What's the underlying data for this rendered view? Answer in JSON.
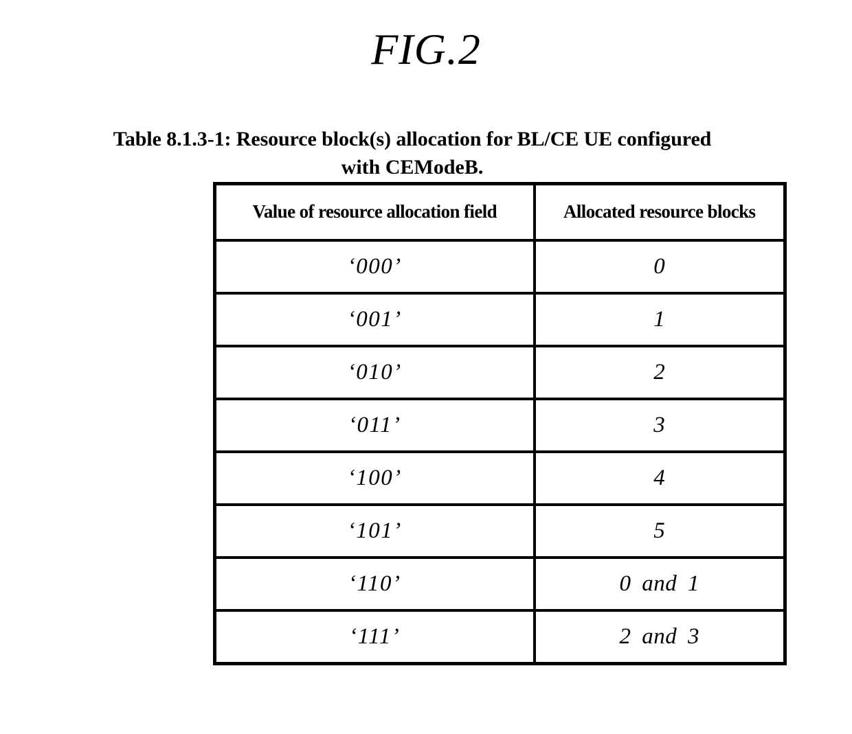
{
  "figure": {
    "title": "FIG.2"
  },
  "caption": {
    "line1": "Table 8.1.3-1: Resource block(s) allocation for BL/CE UE configured",
    "line2": "with CEModeB."
  },
  "table": {
    "headers": {
      "col1": "Value of resource allocation field",
      "col2": "Allocated resource blocks"
    },
    "rows": [
      {
        "value": "‘000’",
        "blocks": "0"
      },
      {
        "value": "‘001’",
        "blocks": "1"
      },
      {
        "value": "‘010’",
        "blocks": "2"
      },
      {
        "value": "‘011’",
        "blocks": "3"
      },
      {
        "value": "‘100’",
        "blocks": "4"
      },
      {
        "value": "‘101’",
        "blocks": "5"
      },
      {
        "value": "‘110’",
        "blocks": "0 and 1"
      },
      {
        "value": "‘111’",
        "blocks": "2 and 3"
      }
    ]
  },
  "colors": {
    "ink": "#000000",
    "paper": "#ffffff"
  }
}
